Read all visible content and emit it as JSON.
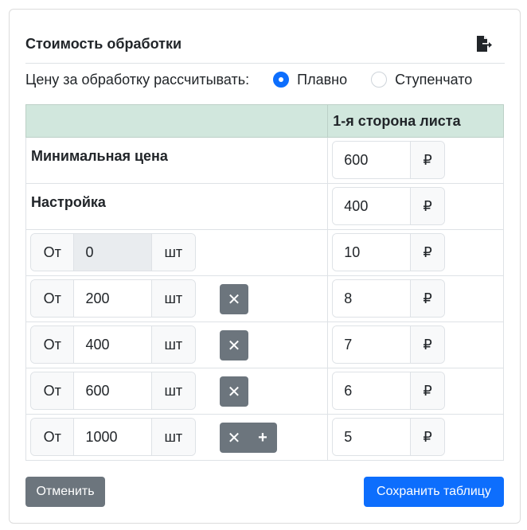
{
  "card": {
    "title": "Стоимость обработки",
    "export_icon": "file-export-icon"
  },
  "mode": {
    "label": "Цену за обработку рассчитывать:",
    "options": [
      {
        "label": "Плавно",
        "checked": true
      },
      {
        "label": "Ступенчато",
        "checked": false
      }
    ]
  },
  "table": {
    "header": {
      "col1": "",
      "col2": "1-я сторона листа"
    },
    "currency": "₽",
    "min_price": {
      "label": "Минимальная цена",
      "value": "600"
    },
    "setup": {
      "label": "Настройка",
      "value": "400"
    },
    "qty_prefix": "От",
    "qty_suffix": "шт",
    "tiers": [
      {
        "from": "0",
        "price": "10"
      },
      {
        "from": "200",
        "price": "8"
      },
      {
        "from": "400",
        "price": "7"
      },
      {
        "from": "600",
        "price": "6"
      },
      {
        "from": "1000",
        "price": "5"
      }
    ],
    "remove_symbol": "✕",
    "add_symbol": "+"
  },
  "footer": {
    "cancel": "Отменить",
    "save": "Сохранить таблицу"
  },
  "colors": {
    "primary": "#0d6efd",
    "secondary": "#6c757d",
    "header_bg": "#d1e7dd"
  }
}
